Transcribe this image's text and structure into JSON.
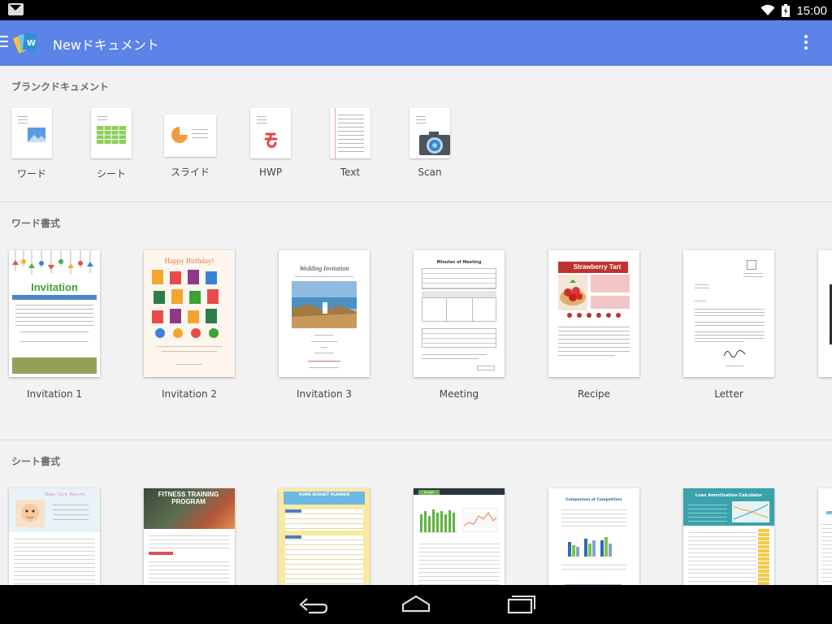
{
  "status_bar": {
    "time": "15:00"
  },
  "app_bar": {
    "title": "Newドキュメント"
  },
  "blank_section": {
    "title": "ブランクドキュメント",
    "items": [
      {
        "label": "ワード",
        "icon": "word-doc-icon"
      },
      {
        "label": "シート",
        "icon": "sheet-doc-icon"
      },
      {
        "label": "スライド",
        "icon": "slide-doc-icon"
      },
      {
        "label": "HWP",
        "icon": "hwp-doc-icon"
      },
      {
        "label": "Text",
        "icon": "text-doc-icon"
      },
      {
        "label": "Scan",
        "icon": "camera-icon"
      }
    ]
  },
  "word_section": {
    "title": "ワード書式",
    "items": [
      {
        "label": "Invitation 1",
        "thumb_title": "Invitation"
      },
      {
        "label": "Invitation 2",
        "thumb_title": "Happy Birthday!"
      },
      {
        "label": "Invitation 3",
        "thumb_title": "Wedding Invitation"
      },
      {
        "label": "Meeting",
        "thumb_title": "Minutes of Meeting"
      },
      {
        "label": "Recipe",
        "thumb_title": "Strawberry Tart"
      },
      {
        "label": "Letter",
        "thumb_title": ""
      }
    ]
  },
  "sheet_section": {
    "title": "シート書式",
    "items": [
      {
        "thumb_title": "Baby Care Record"
      },
      {
        "thumb_title": "FITNESS TRAINING PROGRAM"
      },
      {
        "thumb_title": "HOME BUDGET PLANNER"
      },
      {
        "thumb_title": "Budget Planner"
      },
      {
        "thumb_title": "Comparison of Competitors"
      },
      {
        "thumb_title": "Loan Amortization Calculator"
      }
    ]
  },
  "colors": {
    "app_bar": "#5b83e8",
    "background": "#f2f2f2",
    "invitation_green": "#3aa335",
    "recipe_red": "#c0322f",
    "sheet_green": "#7cc24f",
    "loan_teal": "#3aa2ad"
  }
}
